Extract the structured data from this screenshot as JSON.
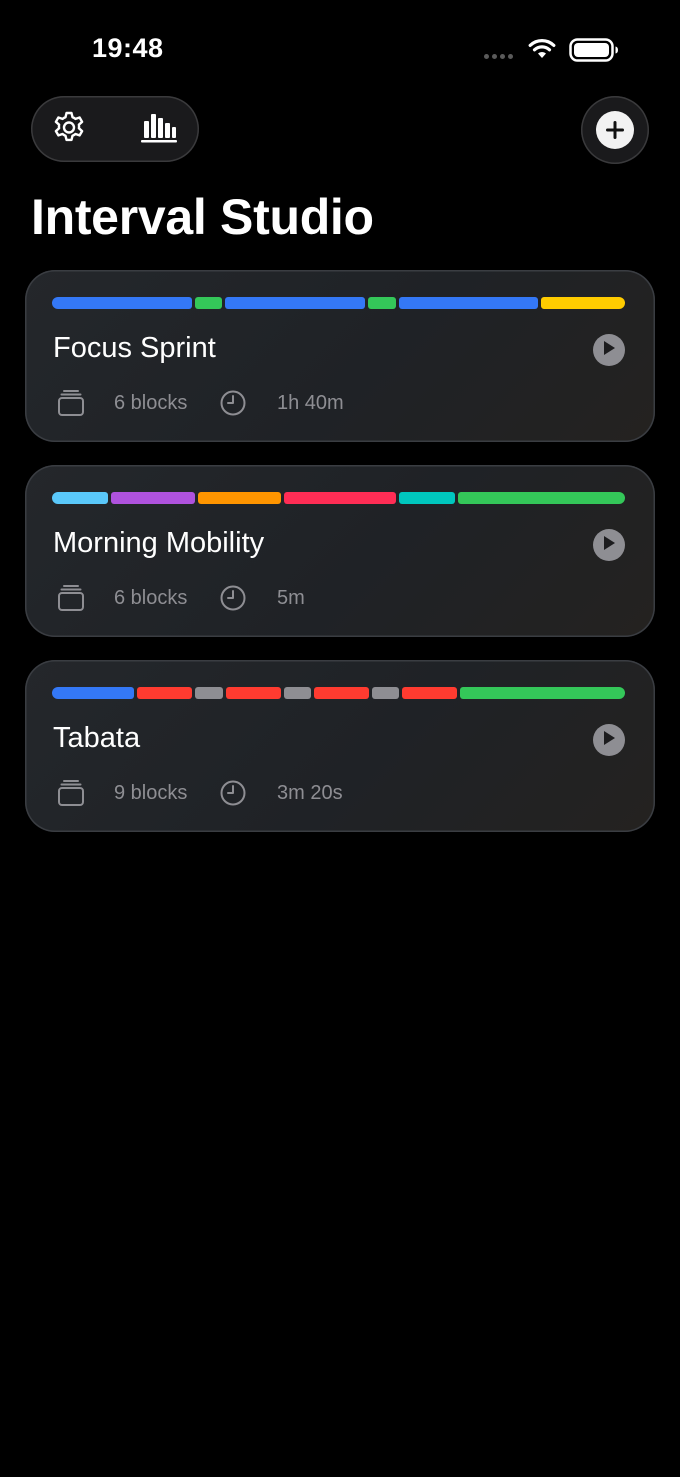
{
  "status_bar": {
    "time": "19:48"
  },
  "header": {
    "settings_icon": "gear-icon",
    "stats_icon": "bar-chart-icon",
    "add_icon": "plus-icon"
  },
  "title": "Interval Studio",
  "colors": {
    "blue": "#3478f6",
    "green": "#34c759",
    "yellow": "#ffcc00",
    "light_blue": "#5ac8fa",
    "purple": "#af52de",
    "orange": "#ff9500",
    "pink": "#ff2d55",
    "teal": "#00c7be",
    "red": "#ff3b30",
    "gray": "#8e8e93"
  },
  "workouts": [
    {
      "name": "Focus Sprint",
      "blocks": "6 blocks",
      "duration": "1h 40m",
      "segments": [
        {
          "color": "#3478f6",
          "weight": 25
        },
        {
          "color": "#34c759",
          "weight": 5
        },
        {
          "color": "#3478f6",
          "weight": 25
        },
        {
          "color": "#34c759",
          "weight": 5
        },
        {
          "color": "#3478f6",
          "weight": 25
        },
        {
          "color": "#ffcc00",
          "weight": 15
        }
      ]
    },
    {
      "name": "Morning Mobility",
      "blocks": "6 blocks",
      "duration": "5m",
      "segments": [
        {
          "color": "#5ac8fa",
          "weight": 30
        },
        {
          "color": "#af52de",
          "weight": 45
        },
        {
          "color": "#ff9500",
          "weight": 45
        },
        {
          "color": "#ff2d55",
          "weight": 60
        },
        {
          "color": "#00c7be",
          "weight": 30
        },
        {
          "color": "#34c759",
          "weight": 90
        }
      ]
    },
    {
      "name": "Tabata",
      "blocks": "9 blocks",
      "duration": "3m 20s",
      "segments": [
        {
          "color": "#3478f6",
          "weight": 30
        },
        {
          "color": "#ff3b30",
          "weight": 20
        },
        {
          "color": "#8e8e93",
          "weight": 10
        },
        {
          "color": "#ff3b30",
          "weight": 20
        },
        {
          "color": "#8e8e93",
          "weight": 10
        },
        {
          "color": "#ff3b30",
          "weight": 20
        },
        {
          "color": "#8e8e93",
          "weight": 10
        },
        {
          "color": "#ff3b30",
          "weight": 20
        },
        {
          "color": "#34c759",
          "weight": 60
        }
      ]
    }
  ]
}
